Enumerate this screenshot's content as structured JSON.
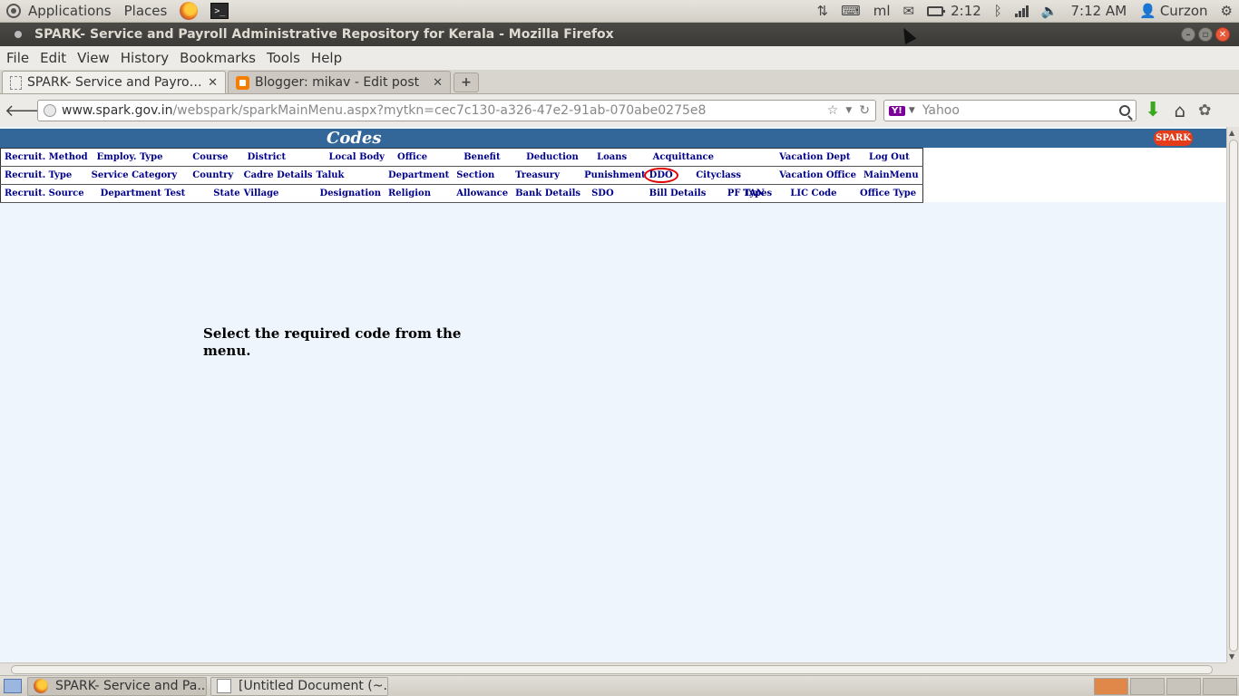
{
  "top_panel": {
    "applications": "Applications",
    "places": "Places",
    "keyboard_layout": "ml",
    "battery_time": "2:12",
    "clock": "7:12 AM",
    "user": "Curzon"
  },
  "window": {
    "title": "SPARK- Service and Payroll Administrative Repository for Kerala - Mozilla Firefox"
  },
  "menubar": {
    "items": [
      "File",
      "Edit",
      "View",
      "History",
      "Bookmarks",
      "Tools",
      "Help"
    ]
  },
  "tabs": [
    {
      "label": "SPARK- Service and Payroll ..."
    },
    {
      "label": "Blogger: mikav - Edit post"
    }
  ],
  "navbar": {
    "url_host": "www.spark.gov.in",
    "url_path": "/webspark/sparkMainMenu.aspx?mytkn=cec7c130-a326-47e2-91ab-070abe0275e8",
    "search_engine": "Yahoo"
  },
  "page": {
    "header_title": "Codes",
    "logo_text": "SPARK",
    "instruction": "Select the required code from the menu.",
    "menu_rows": [
      [
        "Recruit. Method",
        "Employ. Type",
        "Course",
        "District",
        "Local Body",
        "Office",
        "Benefit",
        "Deduction",
        "Loans",
        "Acquittance",
        "Vacation Dept",
        "Log Out"
      ],
      [
        "Recruit. Type",
        "Service Category",
        "Country",
        "Cadre Details",
        "Taluk",
        "Department",
        "Section",
        "Treasury",
        "Punishment",
        "DDO",
        "Cityclass",
        "Vacation Office",
        "MainMenu"
      ],
      [
        "Recruit. Source",
        "Department Test",
        "State",
        "Village",
        "Designation",
        "Religion",
        "Allowance",
        "Bank Details",
        "SDO",
        "Bill Details",
        "PF Types",
        "TAN",
        "LIC Code",
        "Office Type"
      ]
    ]
  },
  "taskbar": {
    "tasks": [
      {
        "label": "SPARK- Service and Pa..."
      },
      {
        "label": "[Untitled Document (~..."
      }
    ]
  },
  "colors": {
    "header_bar": "#336699",
    "link_text": "#000088",
    "content_bg": "#eef5fc",
    "highlight_circle": "#e00000"
  }
}
